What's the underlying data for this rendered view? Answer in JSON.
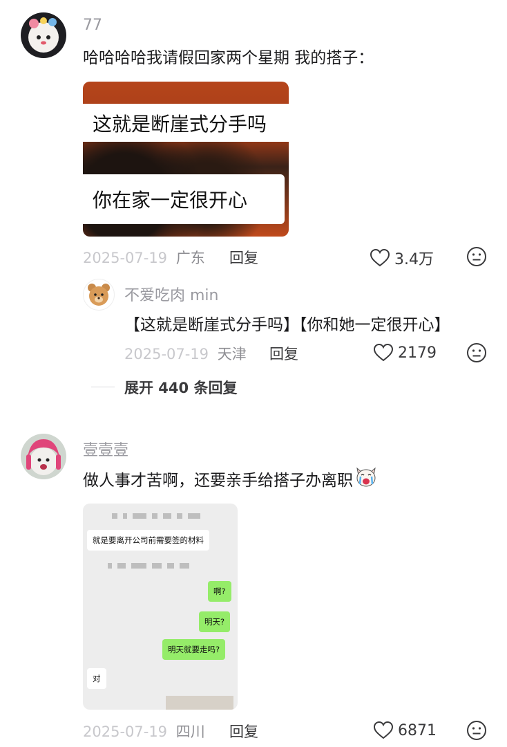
{
  "comments": [
    {
      "username": "77",
      "text": "哈哈哈哈我请假回家两个星期 我的搭子：",
      "image": {
        "caption_top": "这就是断崖式分手吗",
        "caption_bottom": "你在家一定很开心"
      },
      "date": "2025-07-19",
      "location": "广东",
      "reply_label": "回复",
      "likes": "3.4万",
      "reply": {
        "username": "不爱吃肉 min",
        "text": "【这就是断崖式分手吗】【你和她一定很开心】",
        "date": "2025-07-19",
        "location": "天津",
        "reply_label": "回复",
        "likes": "2179"
      },
      "expand_label": "展开 440 条回复"
    },
    {
      "username": "壹壹壹",
      "text": "做人事才苦啊，还要亲手给搭子办离职",
      "emoji": "crying-dog-emoji",
      "chat_image": {
        "msg1": "就是要离开公司前需要签的材料",
        "msg2": "啊?",
        "msg3": "明天?",
        "msg4": "明天就要走吗?",
        "msg5": "对"
      },
      "date": "2025-07-19",
      "location": "四川",
      "reply_label": "回复",
      "likes": "6871"
    }
  ],
  "icons": {
    "like": "heart-outline-icon",
    "dislike": "meh-face-icon"
  },
  "colors": {
    "chat_bubble_self": "#95ec69",
    "chat_background": "#ededed",
    "meta_text": "#b0b0b5"
  }
}
